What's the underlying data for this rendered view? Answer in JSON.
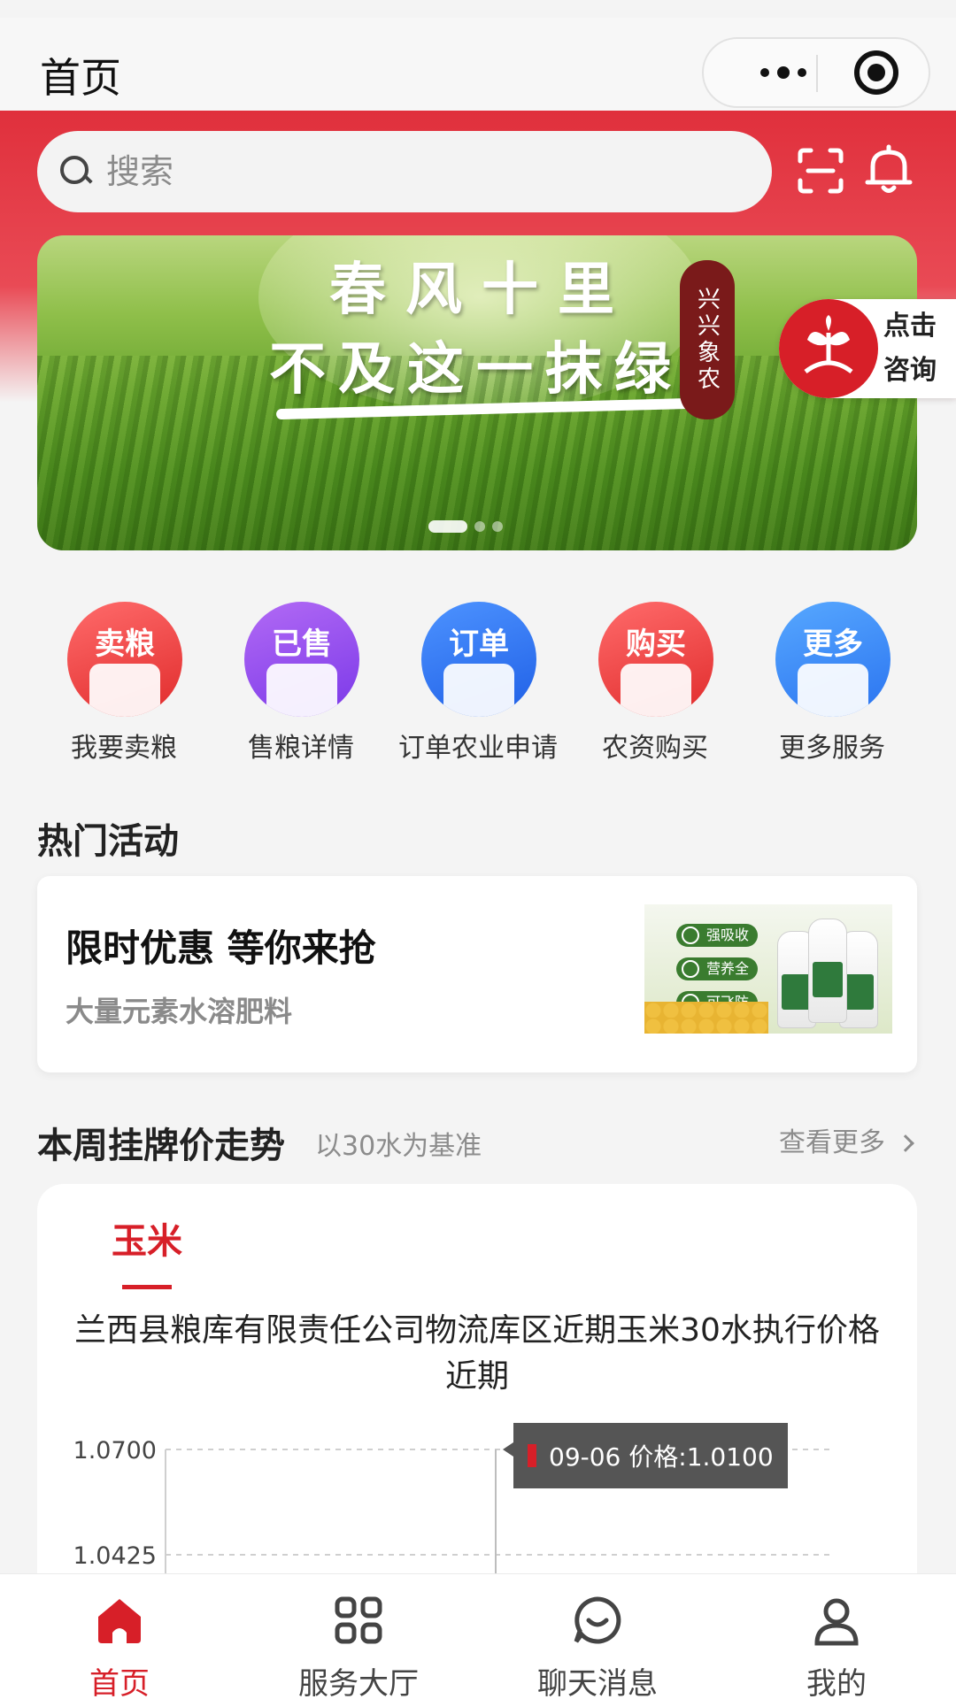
{
  "header": {
    "title": "首页"
  },
  "search": {
    "placeholder": "搜索"
  },
  "banner": {
    "line1": "春风十里",
    "line2": "不及这一抹绿",
    "seal": "兴兴象农",
    "slides": 3,
    "active_slide": 1
  },
  "consult": {
    "label": "点击咨询"
  },
  "services": [
    {
      "badge": "卖粮",
      "label": "我要卖粮",
      "icon": "sell-grain-icon",
      "color": "#e7323c"
    },
    {
      "badge": "已售",
      "label": "售粮详情",
      "icon": "sold-detail-icon",
      "color": "#8a44ee"
    },
    {
      "badge": "订单",
      "label": "订单农业申请",
      "icon": "order-apply-icon",
      "color": "#2a6ff0"
    },
    {
      "badge": "购买",
      "label": "农资购买",
      "icon": "cart-icon",
      "color": "#e7323c"
    },
    {
      "badge": "更多",
      "label": "更多服务",
      "icon": "more-services-icon",
      "color": "#2f7cf4"
    }
  ],
  "hot": {
    "title": "热门活动",
    "promo_title": "限时优惠 等你来抢",
    "promo_sub": "大量元素水溶肥料",
    "product_tags": [
      "强吸收",
      "营养全",
      "可飞防"
    ]
  },
  "trend": {
    "title": "本周挂牌价走势",
    "subtitle": "以30水为基准",
    "more": "查看更多",
    "tab": "玉米",
    "chart_title": "兰西县粮库有限责任公司物流库区近期玉米30水执行价格近期"
  },
  "chart_data": {
    "type": "line",
    "title": "兰西县粮库有限责任公司物流库区近期玉米30水执行价格近期",
    "y_ticks": [
      "1.0700",
      "1.0425"
    ],
    "ylim": [
      1.0425,
      1.07
    ],
    "x": [
      "09-06"
    ],
    "series": [
      {
        "values": [
          1.01
        ]
      }
    ],
    "tooltip": {
      "date": "09-06",
      "text": "09-06 价格:1.0100"
    },
    "grid": true
  },
  "tabbar": [
    {
      "label": "首页",
      "icon": "home-icon",
      "active": true
    },
    {
      "label": "服务大厅",
      "icon": "grid-icon",
      "active": false
    },
    {
      "label": "聊天消息",
      "icon": "chat-icon",
      "active": false
    },
    {
      "label": "我的",
      "icon": "user-icon",
      "active": false
    }
  ],
  "colors": {
    "brand_red": "#d71f28",
    "banner_green": "#6aa530",
    "tooltip_bg": "#555555"
  }
}
